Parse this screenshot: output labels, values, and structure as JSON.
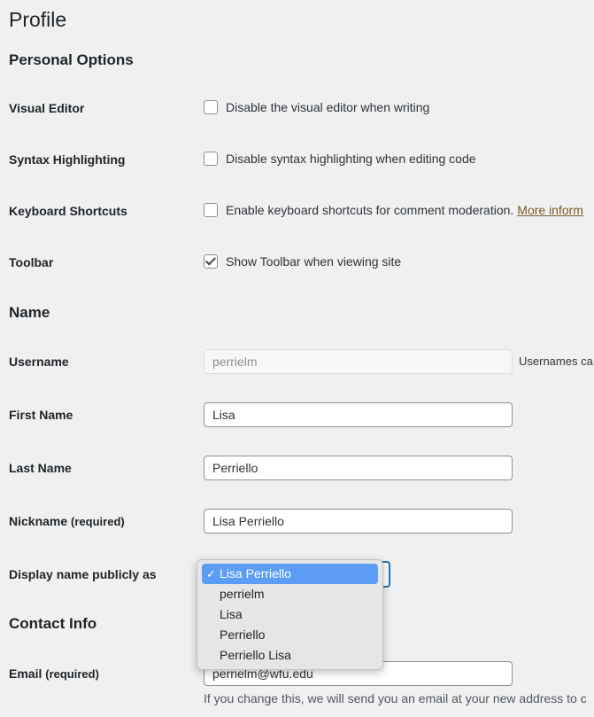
{
  "page": {
    "title": "Profile"
  },
  "personal_options": {
    "heading": "Personal Options",
    "rows": [
      {
        "label": "Visual Editor",
        "text": "Disable the visual editor when writing",
        "checked": false
      },
      {
        "label": "Syntax Highlighting",
        "text": "Disable syntax highlighting when editing code",
        "checked": false
      },
      {
        "label": "Keyboard Shortcuts",
        "text": "Enable keyboard shortcuts for comment moderation.",
        "link": "More inform",
        "checked": false
      },
      {
        "label": "Toolbar",
        "text": "Show Toolbar when viewing site",
        "checked": true
      }
    ]
  },
  "name": {
    "heading": "Name",
    "username": {
      "label": "Username",
      "value": "perrielm",
      "note": "Usernames ca"
    },
    "first_name": {
      "label": "First Name",
      "value": "Lisa"
    },
    "last_name": {
      "label": "Last Name",
      "value": "Perriello"
    },
    "nickname": {
      "label": "Nickname",
      "required": "(required)",
      "value": "Lisa Perriello"
    },
    "display_name": {
      "label": "Display name publicly as",
      "check": "✓",
      "options": [
        "Lisa Perriello",
        "perrielm",
        "Lisa",
        "Perriello",
        "Perriello Lisa"
      ],
      "selected_index": 0
    }
  },
  "contact": {
    "heading": "Contact Info",
    "email": {
      "label": "Email",
      "required": "(required)",
      "value": "perrielm@wfu.edu",
      "help": "If you change this, we will send you an email at your new address to c"
    }
  }
}
